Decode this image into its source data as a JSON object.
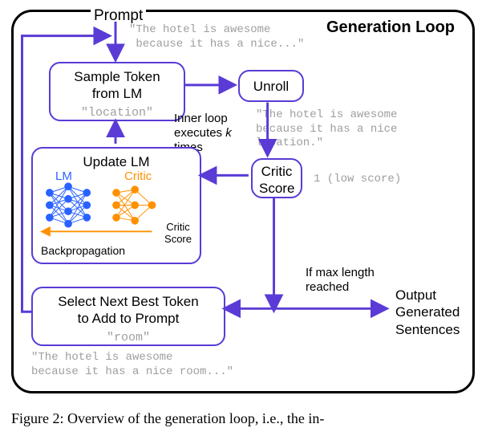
{
  "title": "Generation Loop",
  "promptLabel": "Prompt",
  "promptText": "\"The hotel is awesome\n because it has a nice...\"",
  "sampleBox": {
    "label": "Sample Token\nfrom LM",
    "sub": "\"location\""
  },
  "unrollBox": {
    "label": "Unroll"
  },
  "unrollOutput": "\"The hotel is awesome\nbecause it has a nice\nlocation.\"",
  "innerLoopLabel": "Inner loop\nexecutes k\ntimes",
  "k_symbol": "k",
  "criticBox": {
    "label": "Critic\nScore"
  },
  "criticOutput": "1 (low score)",
  "updateBox": {
    "label": "Update LM",
    "lm": "LM",
    "critic": "Critic",
    "criticScore": "Critic\nScore",
    "backprop": "Backpropagation"
  },
  "selectBox": {
    "label": "Select Next Best Token\nto Add to Prompt",
    "sub": "\"room\""
  },
  "maxLenLabel": "If max length\nreached",
  "outputLabel": "Output\nGenerated\nSentences",
  "finalPrompt": "\"The hotel is awesome\nbecause it has a nice room...\"",
  "caption": "Figure 2: Overview of the generation loop, i.e., the in-"
}
